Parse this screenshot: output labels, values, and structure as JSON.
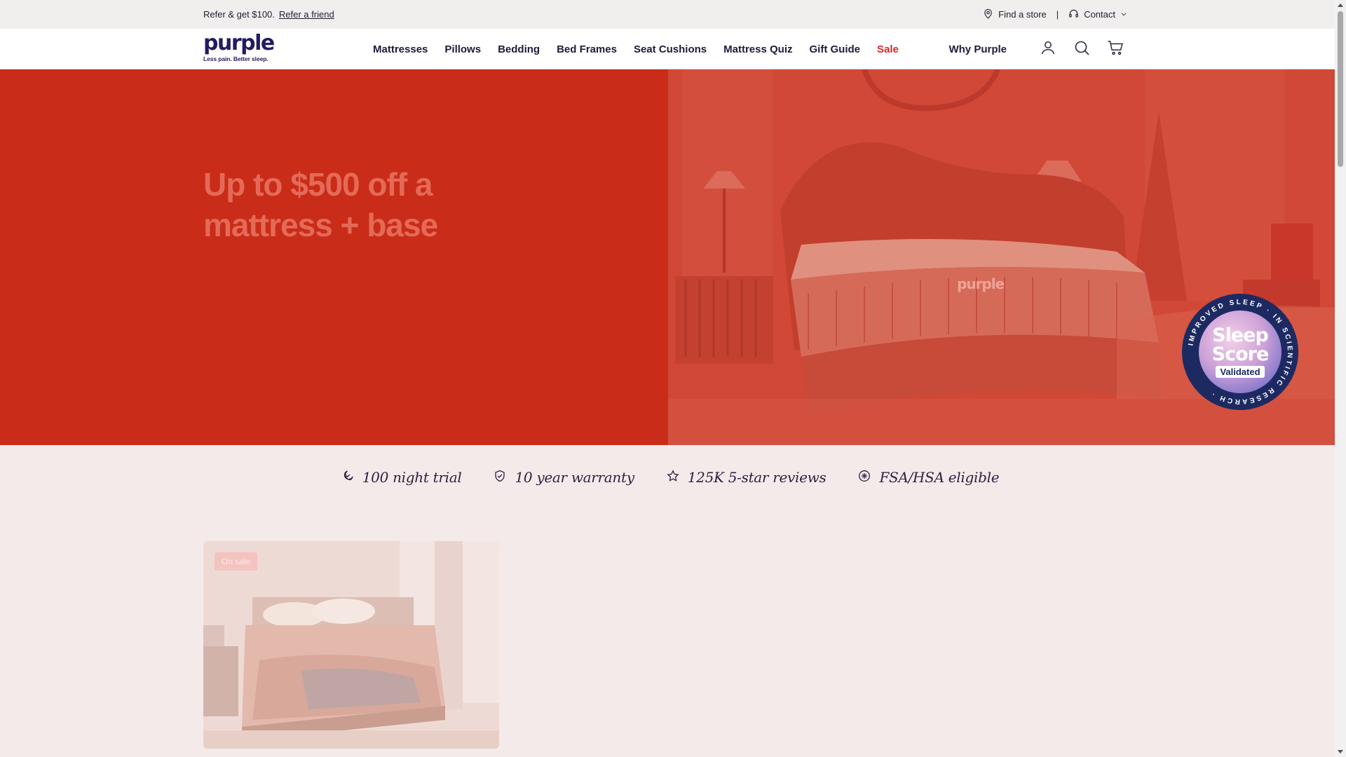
{
  "utility_bar": {
    "promo_text": "Refer & get $100.",
    "promo_link": "Refer a friend",
    "find_store": "Find a store",
    "separator": "|",
    "contact": "Contact"
  },
  "header": {
    "logo_word": "purple",
    "logo_tagline": "Less pain. Better sleep.",
    "nav": [
      {
        "label": "Mattresses"
      },
      {
        "label": "Pillows"
      },
      {
        "label": "Bedding"
      },
      {
        "label": "Bed Frames"
      },
      {
        "label": "Seat Cushions"
      },
      {
        "label": "Mattress Quiz"
      },
      {
        "label": "Gift Guide"
      },
      {
        "label": "Sale"
      }
    ],
    "why_purple": "Why Purple",
    "icons": [
      "account-icon",
      "search-icon",
      "cart-icon"
    ]
  },
  "hero": {
    "title": "Up to $500 off a mattress + base",
    "mattress_logo": "purple",
    "badge": {
      "line1": "Sleep",
      "line2": "Score",
      "tag": "Validated",
      "ring_text": "IMPROVED SLEEP · IN SCIENTIFIC RESEARCH ·"
    },
    "colors": {
      "left_bg": "#c92c18",
      "right_tint": "#d24a38"
    }
  },
  "benefits": [
    {
      "icon": "moon-icon",
      "label": "100 night trial"
    },
    {
      "icon": "shield-check-icon",
      "label": "10 year warranty"
    },
    {
      "icon": "star-icon",
      "label": "125K 5-star reviews"
    },
    {
      "icon": "medical-icon",
      "label": "FSA/HSA eligible"
    }
  ],
  "product_card": {
    "badge": "On sale"
  },
  "colors": {
    "brand": "#231b5f",
    "sale": "#e0232a",
    "page_bg": "#f5eaea"
  }
}
